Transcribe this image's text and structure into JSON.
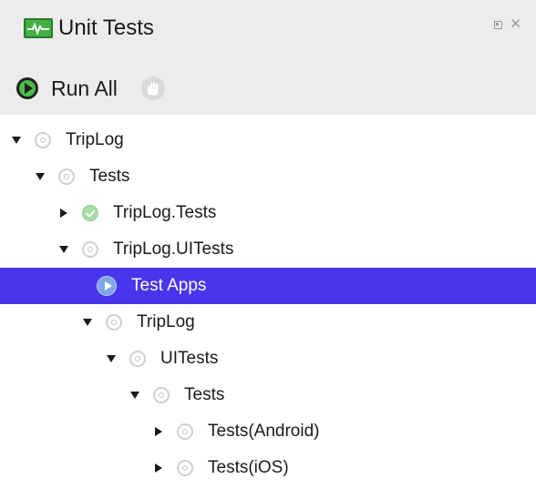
{
  "panel": {
    "title": "Unit Tests",
    "title_icon": "unit-tests-pad-icon",
    "window_controls": [
      "dock-icon",
      "close-icon"
    ]
  },
  "toolbar": {
    "run_all_label": "Run All",
    "run_all_icon": "run-icon",
    "stop_icon": "stop-hand-icon"
  },
  "tree": {
    "items": [
      {
        "label": "TripLog",
        "level": 0,
        "expander": "down",
        "status": "pending",
        "selected": false
      },
      {
        "label": "Tests",
        "level": 1,
        "expander": "down",
        "status": "pending",
        "selected": false
      },
      {
        "label": "TripLog.Tests",
        "level": 2,
        "expander": "right",
        "status": "passed",
        "selected": false
      },
      {
        "label": "TripLog.UITests",
        "level": 2,
        "expander": "down",
        "status": "pending",
        "selected": false
      },
      {
        "label": "Test Apps",
        "level": 3,
        "expander": "none",
        "status": "app",
        "selected": true
      },
      {
        "label": "TripLog",
        "level": 3,
        "expander": "down",
        "status": "pending",
        "selected": false
      },
      {
        "label": "UITests",
        "level": 4,
        "expander": "down",
        "status": "pending",
        "selected": false
      },
      {
        "label": "Tests",
        "level": 5,
        "expander": "down",
        "status": "pending",
        "selected": false
      },
      {
        "label": "Tests(Android)",
        "level": 6,
        "expander": "right",
        "status": "pending",
        "selected": false
      },
      {
        "label": "Tests(iOS)",
        "level": 6,
        "expander": "right",
        "status": "pending",
        "selected": false
      }
    ]
  },
  "colors": {
    "selection": "#4935ec",
    "header_bg": "#ececec",
    "passed": "#a6dca6",
    "run_green": "#4cbb4c"
  }
}
